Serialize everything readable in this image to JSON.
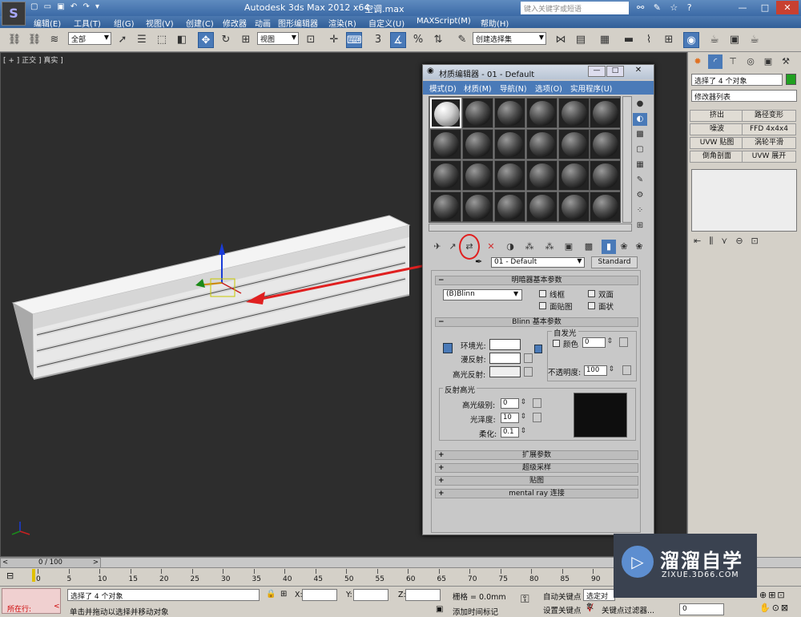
{
  "titlebar": {
    "logo": "S",
    "quick_access": "▢ ▭ ▣ ↶ ↷ ▾",
    "app_title": "Autodesk 3ds Max  2012 x64",
    "file_name": "空调.max",
    "search_placeholder": "键入关键字或短语",
    "min": "—",
    "max": "□",
    "close": "✕"
  },
  "menubar": [
    "编辑(E)",
    "工具(T)",
    "组(G)",
    "视图(V)",
    "创建(C)",
    "修改器",
    "动画",
    "图形编辑器",
    "渲染(R)",
    "自定义(U)",
    "MAXScript(M)",
    "帮助(H)"
  ],
  "toolbar": {
    "selection_filter": "全部",
    "ref_coord": "视图",
    "named_selection": "创建选择集"
  },
  "viewport": {
    "label": "[ + ] 正交 ] 真实 ]"
  },
  "material_editor": {
    "title": "材质编辑器 - 01 - Default",
    "menu": [
      "模式(D)",
      "材质(M)",
      "导航(N)",
      "选项(O)",
      "实用程序(U)"
    ],
    "material_name": "01 - Default",
    "material_type": "Standard",
    "rollouts": {
      "shader_basic": "明暗器基本参数",
      "blinn_basic": "Blinn 基本参数",
      "extended": "扩展参数",
      "supersampling": "超级采样",
      "maps": "贴图",
      "mental_ray": "mental ray 连接"
    },
    "shader": "(B)Blinn",
    "shader_options": [
      "线框",
      "双面",
      "面贴图",
      "面状"
    ],
    "blinn": {
      "ambient": "环境光:",
      "diffuse": "漫反射:",
      "specular": "高光反射:",
      "self_illum": "自发光",
      "color_label": "颜色",
      "color_value": "0",
      "opacity_label": "不透明度:",
      "opacity_value": "100",
      "spec_highlights": "反射高光",
      "spec_level_label": "高光级别:",
      "spec_level_value": "0",
      "gloss_label": "光泽度:",
      "gloss_value": "10",
      "soften_label": "柔化:",
      "soften_value": "0.1"
    }
  },
  "command_panel": {
    "selection_info": "选择了 4 个对象",
    "modifier_list": "修改器列表",
    "modifiers": [
      "挤出",
      "路径变形",
      "噪波",
      "FFD 4x4x4",
      "UVW 贴图",
      "涡轮平滑",
      "倒角剖面",
      "UVW 展开"
    ]
  },
  "timeline": {
    "frame_display": "0 / 100",
    "ticks": [
      "0",
      "5",
      "10",
      "15",
      "20",
      "25",
      "30",
      "35",
      "40",
      "45",
      "50",
      "55",
      "60",
      "65",
      "70",
      "75",
      "80",
      "85",
      "90"
    ]
  },
  "status": {
    "script_label": "所在行:",
    "selection_status": "选择了 4 个对象",
    "prompt": "单击并拖动以选择并移动对象",
    "x_label": "X:",
    "y_label": "Y:",
    "z_label": "Z:",
    "grid": "栅格 = 0.0mm",
    "add_time_tag": "添加时间标记",
    "auto_key": "自动关键点",
    "auto_key_value": "选定对象",
    "set_key": "设置关键点",
    "key_filters": "关键点过滤器...",
    "frame_value": "0"
  },
  "watermark": {
    "brand": "溜溜自学",
    "url": "ZIXUE.3D66.COM"
  }
}
